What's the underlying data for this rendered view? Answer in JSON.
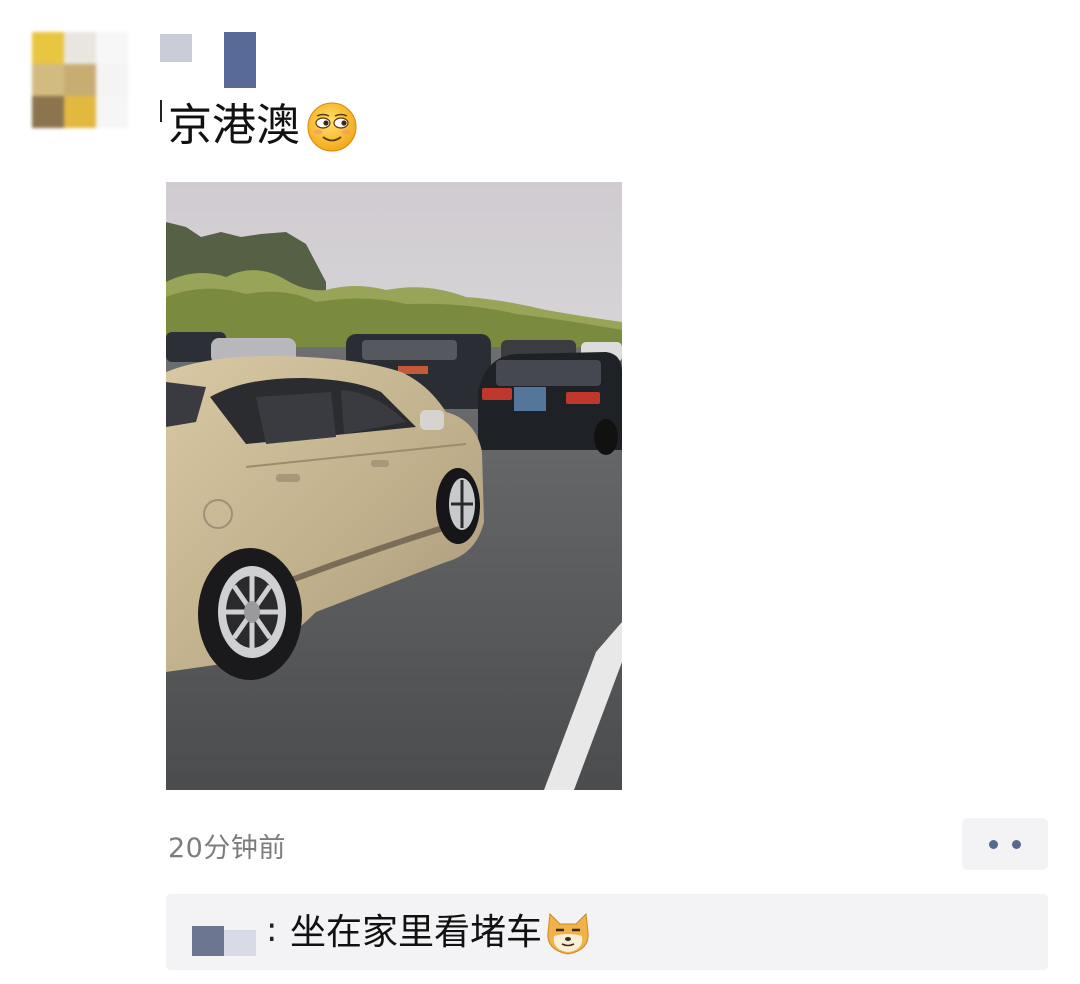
{
  "post": {
    "author_avatar_colors": [
      "#e8c640",
      "#e9e6e0",
      "#f7f7f7",
      "#d2bb80",
      "#c8ad72",
      "#f4f4f4",
      "#8c744e",
      "#e3b840",
      "#f6f6f6"
    ],
    "author_name_colors": [
      "#c9ccd6",
      "#5a6a98"
    ],
    "text": "京港澳",
    "text_emoji": "smirking-face-emoji",
    "image": {
      "description_icon": "traffic-jam-photo",
      "car_plate_color": "#5b80a8"
    },
    "timestamp": "20分钟前",
    "more_icon": "more-dots-icon",
    "accent_color": "#57698f"
  },
  "comments": [
    {
      "author_colors": [
        "#6c7690",
        "#d8dbe6"
      ],
      "separator": ":",
      "text": "坐在家里看堵车",
      "emoji": "shiba-dog-face-emoji"
    }
  ]
}
